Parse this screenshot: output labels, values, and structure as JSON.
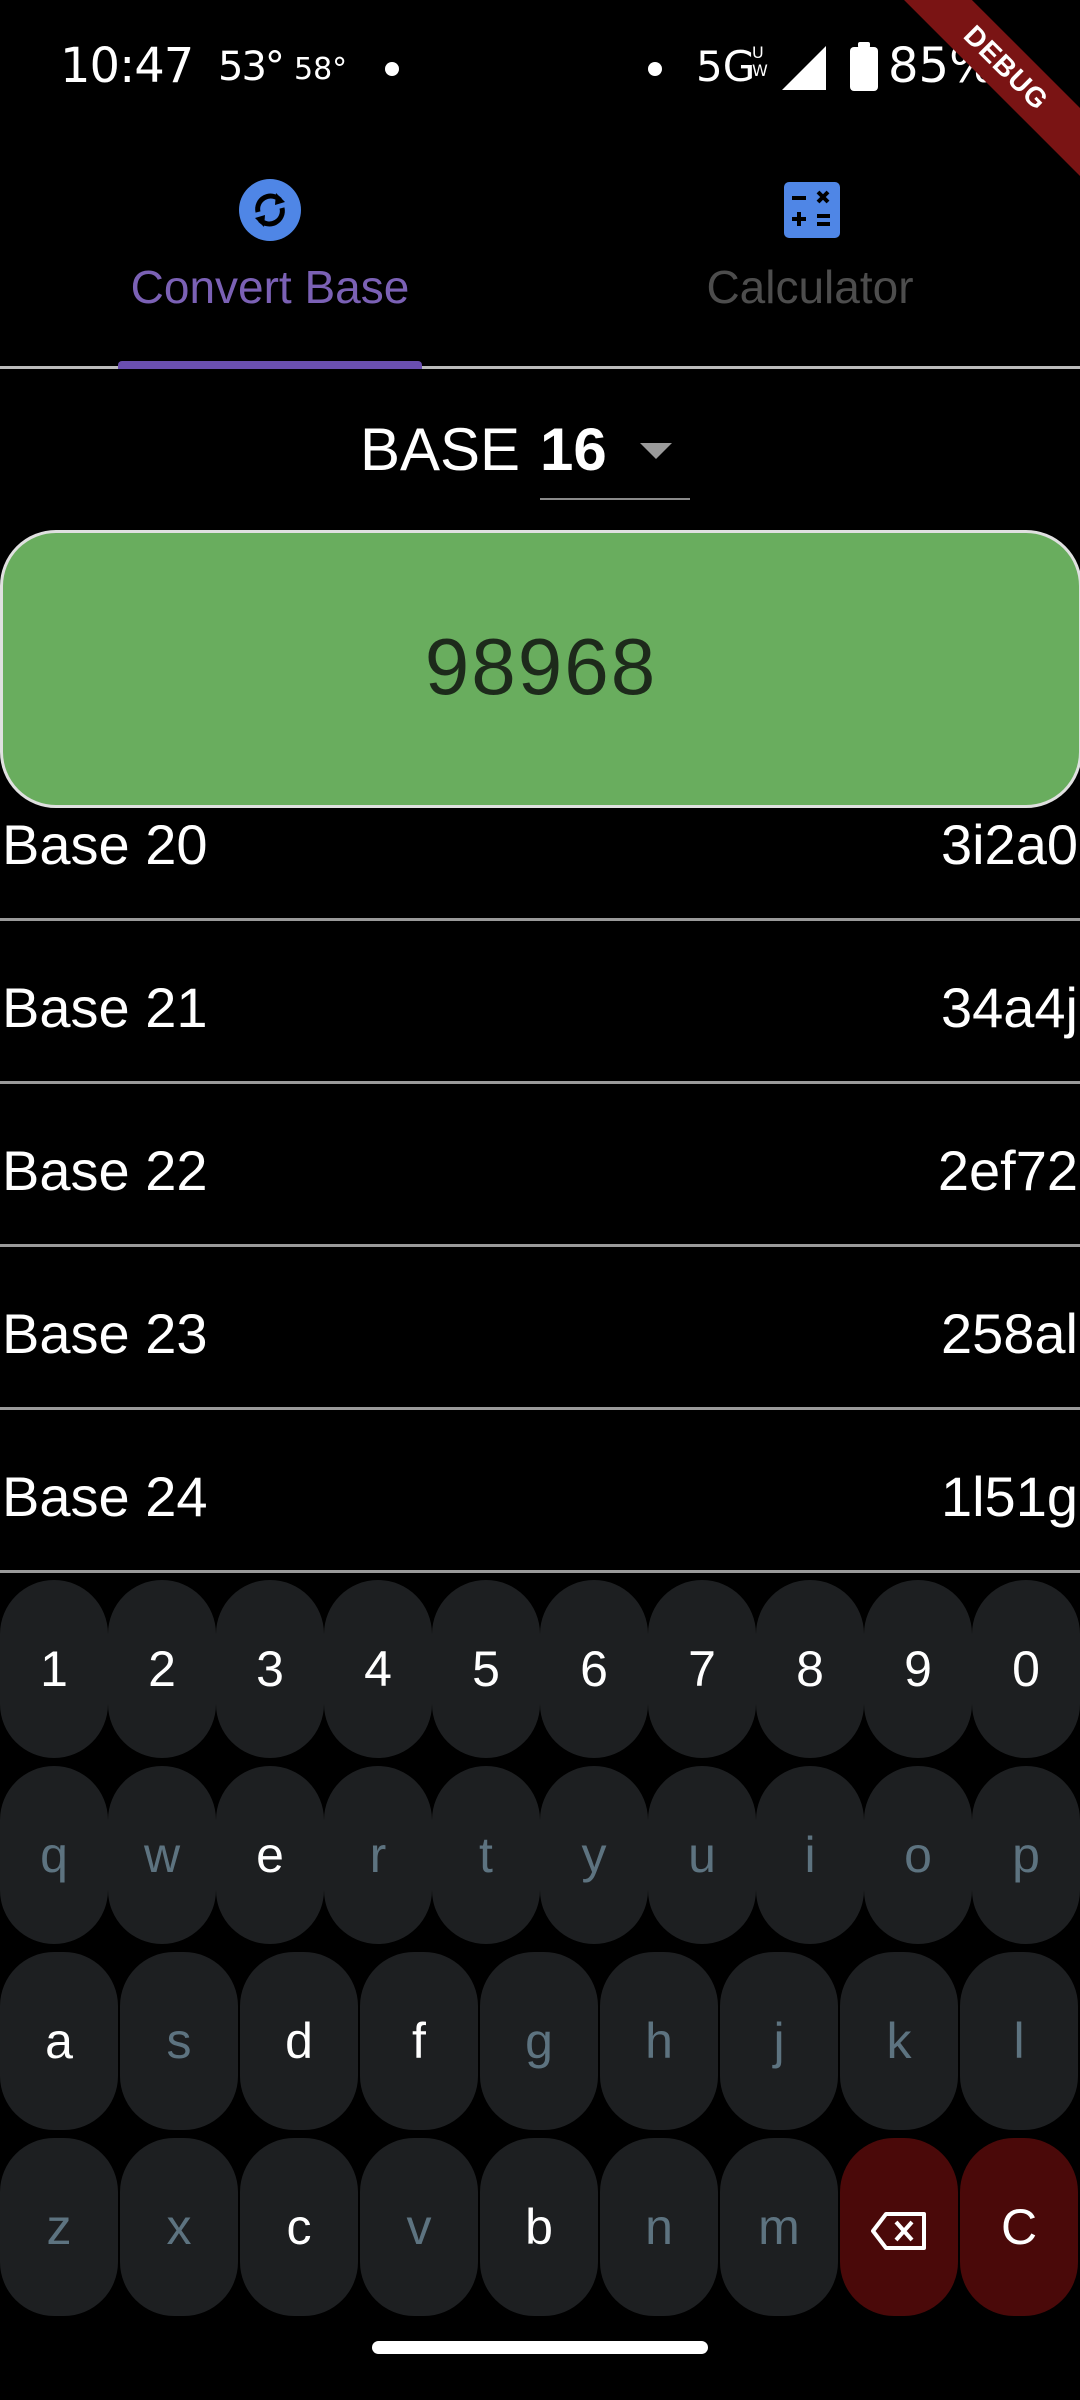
{
  "status_bar": {
    "time": "10:47",
    "temp_current": "53°",
    "temp_other": "58°",
    "network": "5G",
    "network_sub": "U W",
    "battery_percent": "85%"
  },
  "debug_banner": "DEBUG",
  "tabs": [
    {
      "label": "Convert Base",
      "icon": "sync-icon",
      "selected": true
    },
    {
      "label": "Calculator",
      "icon": "calculator-icon",
      "selected": false
    }
  ],
  "base_selector": {
    "label": "BASE",
    "value": "16"
  },
  "input_display": {
    "value": "98968"
  },
  "results": [
    {
      "base": "Base 20",
      "value": "3i2a0"
    },
    {
      "base": "Base 21",
      "value": "34a4j"
    },
    {
      "base": "Base 22",
      "value": "2ef72"
    },
    {
      "base": "Base 23",
      "value": "258al"
    },
    {
      "base": "Base 24",
      "value": "1l51g"
    }
  ],
  "keyboard": {
    "row1": [
      "1",
      "2",
      "3",
      "4",
      "5",
      "6",
      "7",
      "8",
      "9",
      "0"
    ],
    "row2": [
      "q",
      "w",
      "e",
      "r",
      "t",
      "y",
      "u",
      "i",
      "o",
      "p"
    ],
    "row3": [
      "a",
      "s",
      "d",
      "f",
      "g",
      "h",
      "j",
      "k",
      "l"
    ],
    "row4": [
      "z",
      "x",
      "c",
      "v",
      "b",
      "n",
      "m"
    ],
    "clear_label": "C",
    "backspace_icon": "backspace-icon",
    "enabled_keys": [
      "1",
      "2",
      "3",
      "4",
      "5",
      "6",
      "7",
      "8",
      "9",
      "0",
      "e",
      "a",
      "d",
      "f",
      "c",
      "b"
    ]
  },
  "colors": {
    "accent": "#6a4fb0",
    "display_bg": "#69ad5e",
    "key_bg": "#1d1f21",
    "key_disabled_text": "#5d7380",
    "danger_bg": "#4a0909"
  }
}
